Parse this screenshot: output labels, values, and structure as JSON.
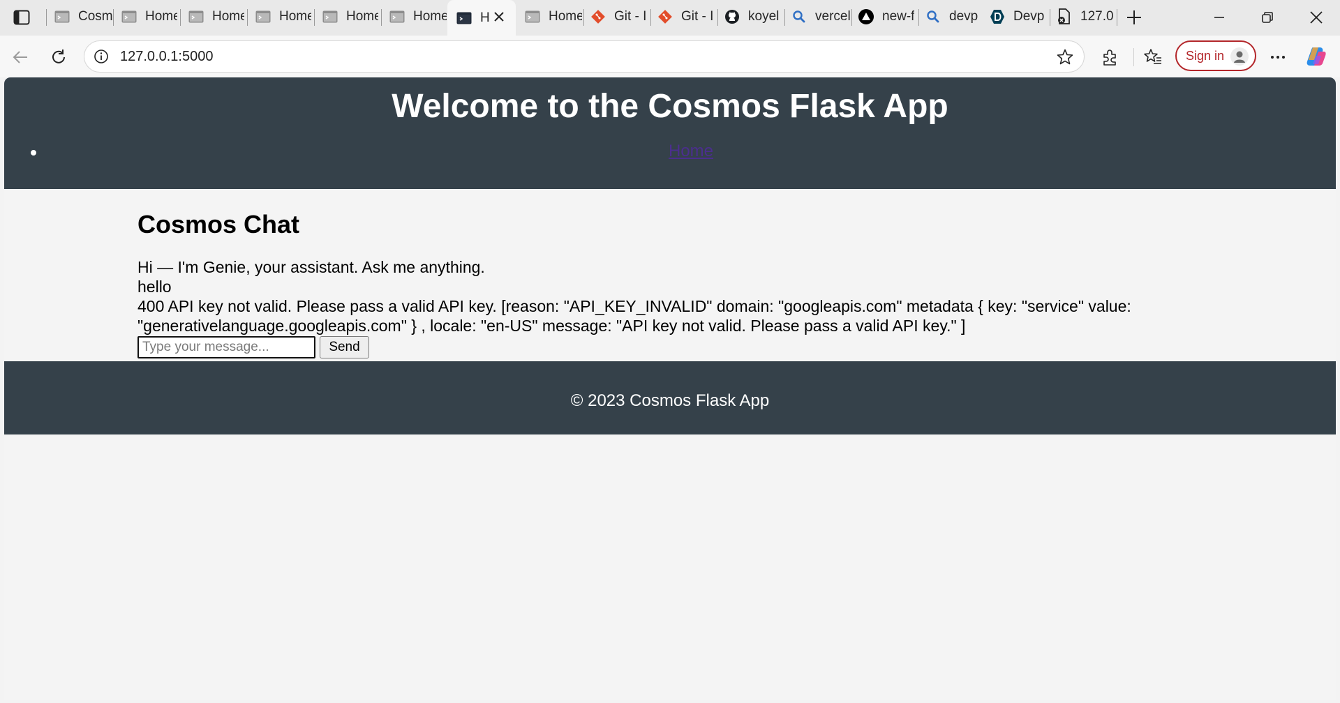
{
  "browser": {
    "tabs": [
      {
        "title": "Cosm",
        "icon": "terminal-icon"
      },
      {
        "title": "Home",
        "icon": "terminal-icon"
      },
      {
        "title": "Home",
        "icon": "terminal-icon"
      },
      {
        "title": "Home",
        "icon": "terminal-icon"
      },
      {
        "title": "Home",
        "icon": "terminal-icon"
      },
      {
        "title": "Home",
        "icon": "terminal-icon"
      },
      {
        "title": "H",
        "icon": "terminal-icon",
        "active": true
      },
      {
        "title": "Home",
        "icon": "terminal-icon"
      },
      {
        "title": "Git - I",
        "icon": "git-icon"
      },
      {
        "title": "Git - I",
        "icon": "git-icon"
      },
      {
        "title": "koyel",
        "icon": "github-icon"
      },
      {
        "title": "vercel",
        "icon": "search-icon"
      },
      {
        "title": "new-f",
        "icon": "vercel-icon"
      },
      {
        "title": "devp",
        "icon": "search-icon"
      },
      {
        "title": "Devp",
        "icon": "devpost-icon"
      },
      {
        "title": "127.0",
        "icon": "page-error-icon"
      }
    ],
    "address_bar": {
      "url": "127.0.0.1:5000"
    },
    "sign_in_label": "Sign in",
    "colors": {
      "accent": "#b3262a",
      "header_bg": "#35414a",
      "link": "#4b2e8e"
    }
  },
  "page": {
    "header": {
      "title": "Welcome to the Cosmos Flask App",
      "nav": [
        {
          "label": "Home"
        }
      ]
    },
    "chat": {
      "heading": "Cosmos Chat",
      "messages": [
        "Hi — I'm Genie, your assistant. Ask me anything.",
        "hello",
        "400 API key not valid. Please pass a valid API key. [reason: \"API_KEY_INVALID\" domain: \"googleapis.com\" metadata { key: \"service\" value: \"generativelanguage.googleapis.com\" } , locale: \"en-US\" message: \"API key not valid. Please pass a valid API key.\" ]"
      ],
      "input_placeholder": "Type your message...",
      "input_value": "",
      "send_label": "Send"
    },
    "footer": {
      "text": "© 2023 Cosmos Flask App"
    }
  }
}
